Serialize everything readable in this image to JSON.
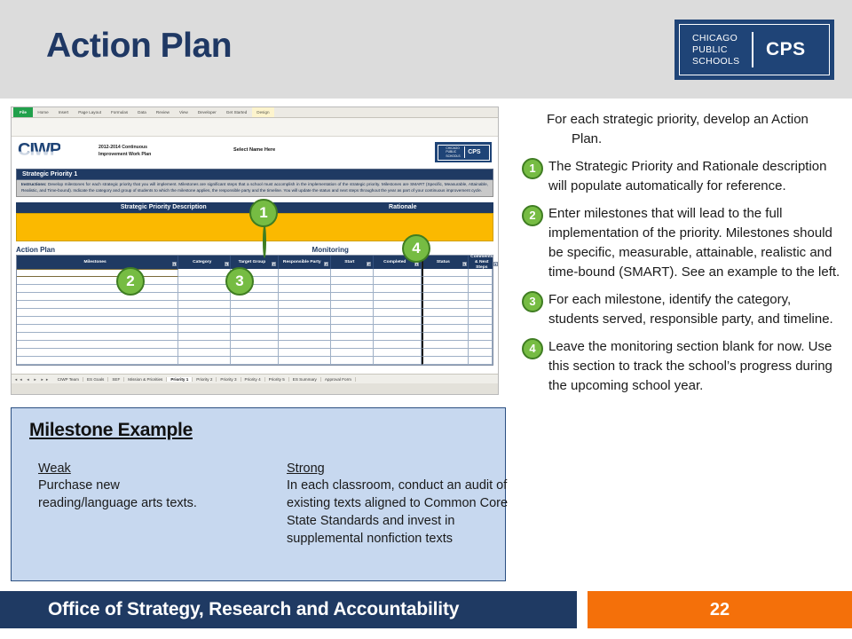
{
  "header": {
    "title": "Action Plan",
    "logo": {
      "words": "CHICAGO\nPUBLIC\nSCHOOLS",
      "line1": "CHICAGO",
      "line2": "PUBLIC",
      "line3": "SCHOOLS",
      "abbr": "CPS"
    }
  },
  "screenshot": {
    "ribbon_tabs": [
      "File",
      "Home",
      "Insert",
      "Page Layout",
      "Formulas",
      "Data",
      "Review",
      "View",
      "Developer",
      "Get Started",
      "Design"
    ],
    "ciwp": {
      "logo": "CIWP",
      "subtitle_line1": "2012-2014 Continuous",
      "subtitle_line2": "Improvement Work Plan",
      "select_name": "Select Name Here",
      "cps_line1": "CHICAGO",
      "cps_line2": "PUBLIC",
      "cps_line3": "SCHOOLS",
      "cps_abbr": "CPS"
    },
    "priority_title": "Strategic Priority 1",
    "instructions_label": "Instructions:",
    "instructions_text": "Develop milestones for each strategic priority that you will implement. Milestones are significant steps that a school must accomplish in the implementation of the strategic priority. Milestones are SMART (Specific, Measurable, Attainable, Realistic, and Time-bound). Indicate the category and group of students to which the milestone applies, the responsible party and the timeline. You will update the status and next steps throughout the year as part of your continuous improvement cycle.",
    "desc_header": {
      "col1": "Strategic Priority Description",
      "col2": "Rationale"
    },
    "section_action_plan": "Action Plan",
    "section_monitoring": "Monitoring",
    "table_headers": [
      "Milestones",
      "Category",
      "Target Group",
      "Responsible Party",
      "Start",
      "Completed",
      "Status",
      "Comments & Next Steps"
    ],
    "filter_glyph": "▾",
    "nav_arrows": "◄◄ ◄ ► ►►",
    "sheet_tabs": [
      "CIWP Team",
      "ES Goals",
      "SEF",
      "Mission & Priorities",
      "Priority 1",
      "Priority 2",
      "Priority 3",
      "Priority 4",
      "Priority 5",
      "ES Summary",
      "Approval Form"
    ],
    "active_sheet": "Priority 1",
    "callouts": [
      "1",
      "2",
      "3",
      "4"
    ]
  },
  "milestone_example": {
    "title": "Milestone Example",
    "weak_label": "Weak",
    "weak_text": "Purchase new reading/language arts texts.",
    "strong_label": "Strong",
    "strong_text": "In each classroom, conduct an audit of existing texts aligned to Common Core State Standards and invest in supplemental nonfiction texts"
  },
  "instructions": {
    "intro": "For each strategic priority, develop an Action Plan.",
    "steps": [
      {
        "number": "1",
        "text": "The Strategic Priority and Rationale description will populate automatically for reference."
      },
      {
        "number": "2",
        "text": "Enter milestones that will lead to the full implementation of the priority.  Milestones should be specific, measurable, attainable, realistic and time-bound (SMART).  See an example to the left."
      },
      {
        "number": "3",
        "text": "For each milestone, identify the category, students served, responsible party, and timeline."
      },
      {
        "number": "4",
        "text": "Leave the monitoring section blank for now.  Use this section to track the school’s progress during the upcoming school year."
      }
    ]
  },
  "footer": {
    "office": "Office of Strategy, Research and Accountability",
    "page_number": "22"
  },
  "colors": {
    "navy": "#1f3a63",
    "orange": "#f4700a",
    "green": "#76bc43",
    "green_ring": "#3f7d22",
    "yellow": "#fbb900",
    "light_blue": "#c7d8ef",
    "header_gray": "#dcdcdc"
  }
}
